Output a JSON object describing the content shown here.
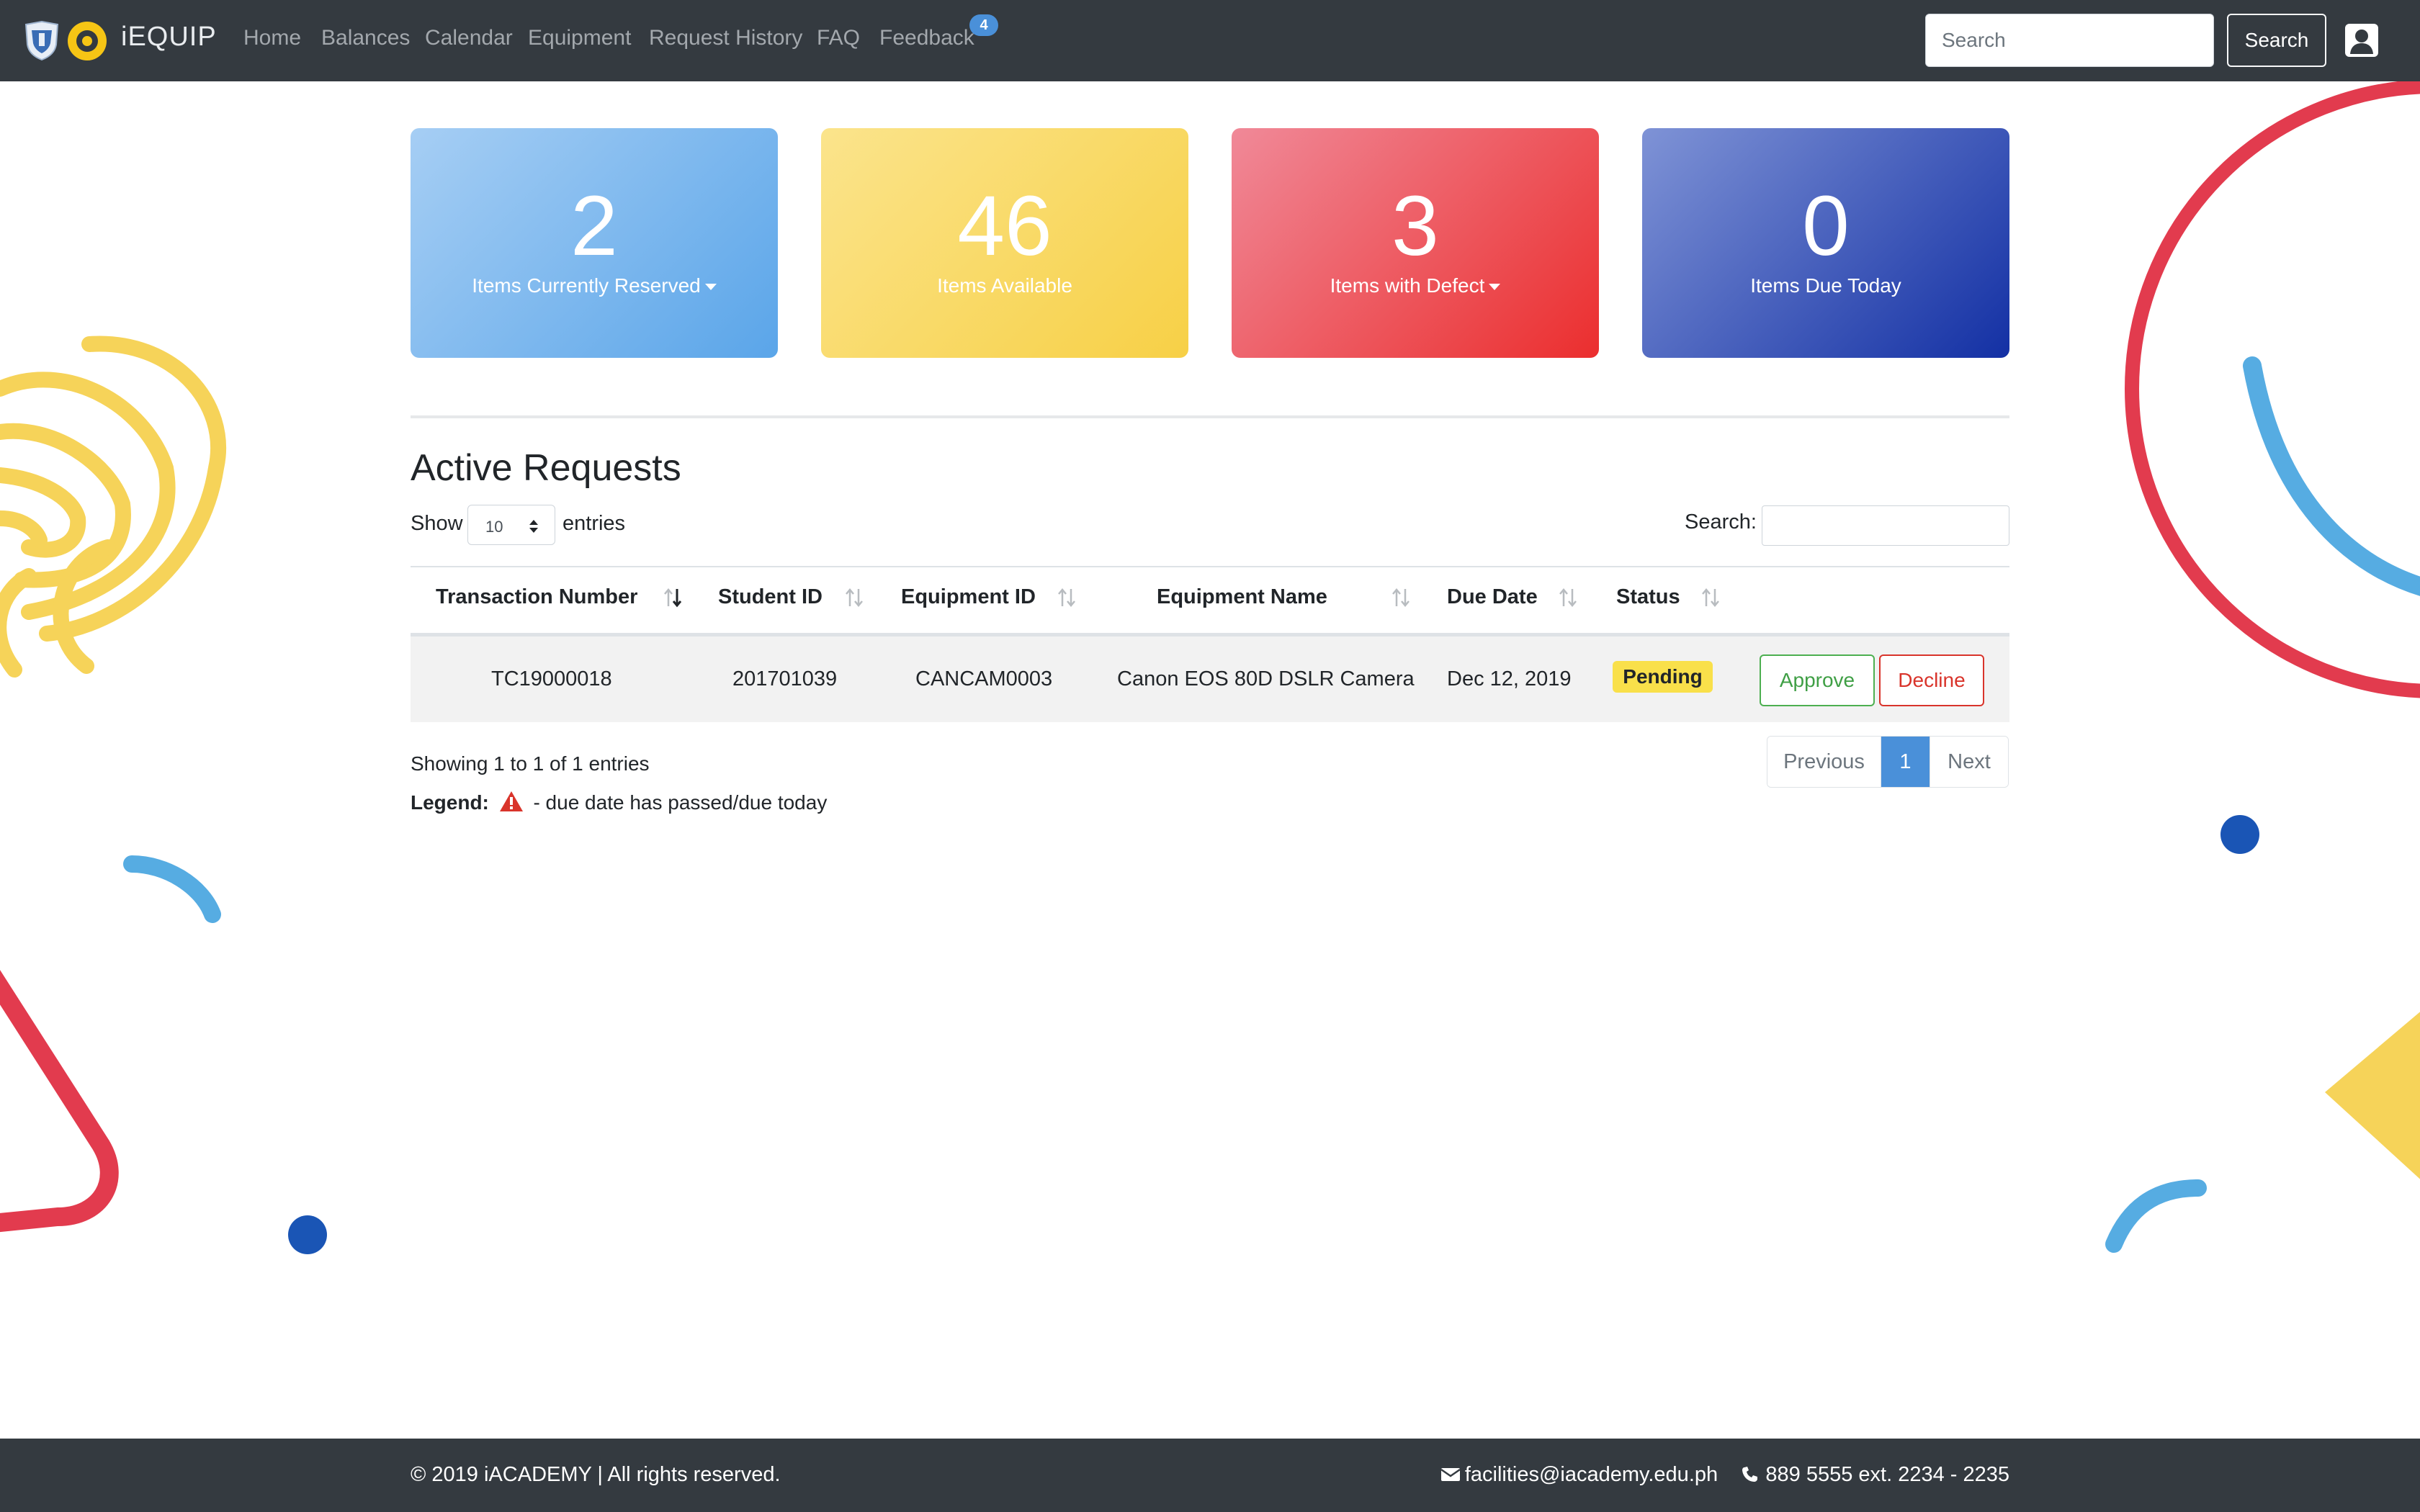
{
  "navbar": {
    "brand": "iEQUIP",
    "links": [
      "Home",
      "Balances",
      "Calendar",
      "Equipment",
      "Request History",
      "FAQ",
      "Feedback"
    ],
    "feedback_badge": "4",
    "search_placeholder": "Search",
    "search_button": "Search",
    "icons": [
      "school-shield-logo-icon",
      "iacademy-logo-icon",
      "user-account-icon"
    ]
  },
  "stats": [
    {
      "value": "2",
      "label": "Items Currently Reserved",
      "dropdown": true,
      "color_from": "#a6cef4",
      "color_to": "#5aa5e9"
    },
    {
      "value": "46",
      "label": "Items Available",
      "dropdown": false,
      "color_from": "#fbe48c",
      "color_to": "#f7d046"
    },
    {
      "value": "3",
      "label": "Items with Defect",
      "dropdown": true,
      "color_from": "#f08998",
      "color_to": "#eb2e2e"
    },
    {
      "value": "0",
      "label": "Items Due Today",
      "dropdown": false,
      "color_from": "#7f93d6",
      "color_to": "#1330a4"
    }
  ],
  "requests": {
    "title": "Active Requests",
    "show_label": "Show",
    "entries_value": "10",
    "entries_label": "entries",
    "search_label": "Search:",
    "columns": [
      "Transaction Number",
      "Student ID",
      "Equipment ID",
      "Equipment Name",
      "Due Date",
      "Status"
    ],
    "rows": [
      {
        "transaction_number": "TC19000018",
        "student_id": "201701039",
        "equipment_id": "CANCAM0003",
        "equipment_name": "Canon EOS 80D DSLR Camera",
        "due_date": "Dec 12, 2019",
        "status": "Pending",
        "approve_label": "Approve",
        "decline_label": "Decline"
      }
    ],
    "info": "Showing 1 to 1 of 1 entries",
    "legend_label": "Legend:",
    "legend_text": "- due date has passed/due today",
    "pagination": {
      "previous": "Previous",
      "current": "1",
      "next": "Next"
    }
  },
  "footer": {
    "copyright": "© 2019 iACADEMY | All rights reserved.",
    "email": "facilities@iacademy.edu.ph",
    "phone": "889 5555 ext. 2234 - 2235"
  },
  "colors": {
    "navbar": "#343a40",
    "accent_blue": "#4a90d9",
    "status_pending": "#f9e04a",
    "approve": "#4caf50",
    "decline": "#d9342b",
    "deco_red": "#e23b4e",
    "deco_yellow": "#f6d359",
    "deco_blue": "#56ace2",
    "deco_navy": "#1a55b5"
  }
}
